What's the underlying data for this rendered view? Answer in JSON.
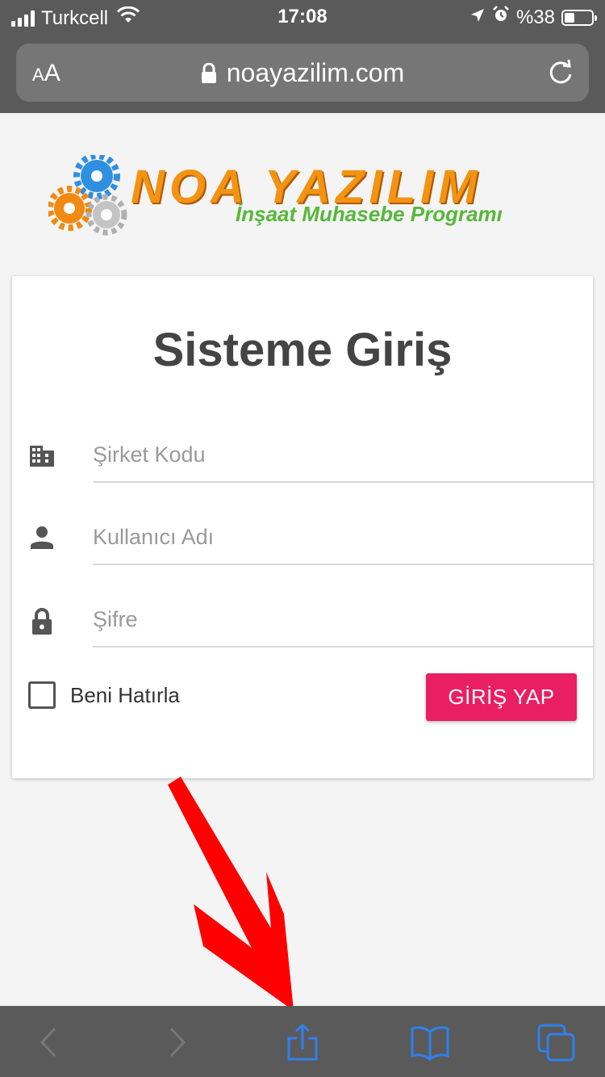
{
  "status_bar": {
    "carrier": "Turkcell",
    "time": "17:08",
    "battery_text": "%38",
    "battery_level": 0.38,
    "icons": [
      "signal-icon",
      "wifi-icon",
      "location-arrow-icon",
      "alarm-icon",
      "battery-icon"
    ]
  },
  "address_bar": {
    "text_size_label_small": "A",
    "text_size_label_large": "A",
    "url": "noayazilim.com",
    "icons": [
      "lock-icon",
      "reload-icon"
    ]
  },
  "logo": {
    "title": "NOA YAZILIM",
    "subtitle": "İnşaat Muhasebe Programı",
    "colors": {
      "title": "#f39313",
      "subtitle": "#57b73a",
      "gear_blue": "#2f8fe0",
      "gear_orange": "#f08a12",
      "gear_gray": "#b0b0b0"
    }
  },
  "login": {
    "title": "Sisteme Giriş",
    "company_code_placeholder": "Şirket Kodu",
    "username_placeholder": "Kullanıcı Adı",
    "password_placeholder": "Şifre",
    "remember_label": "Beni Hatırla",
    "remember_checked": false,
    "submit_label": "GİRİŞ YAP",
    "accent_color": "#e91e63"
  },
  "toolbar": {
    "icons": [
      "back-icon",
      "forward-icon",
      "share-icon",
      "bookmarks-icon",
      "tabs-icon"
    ],
    "active_color": "#2f80ed"
  },
  "annotation": {
    "arrow_color": "#ff0000"
  }
}
